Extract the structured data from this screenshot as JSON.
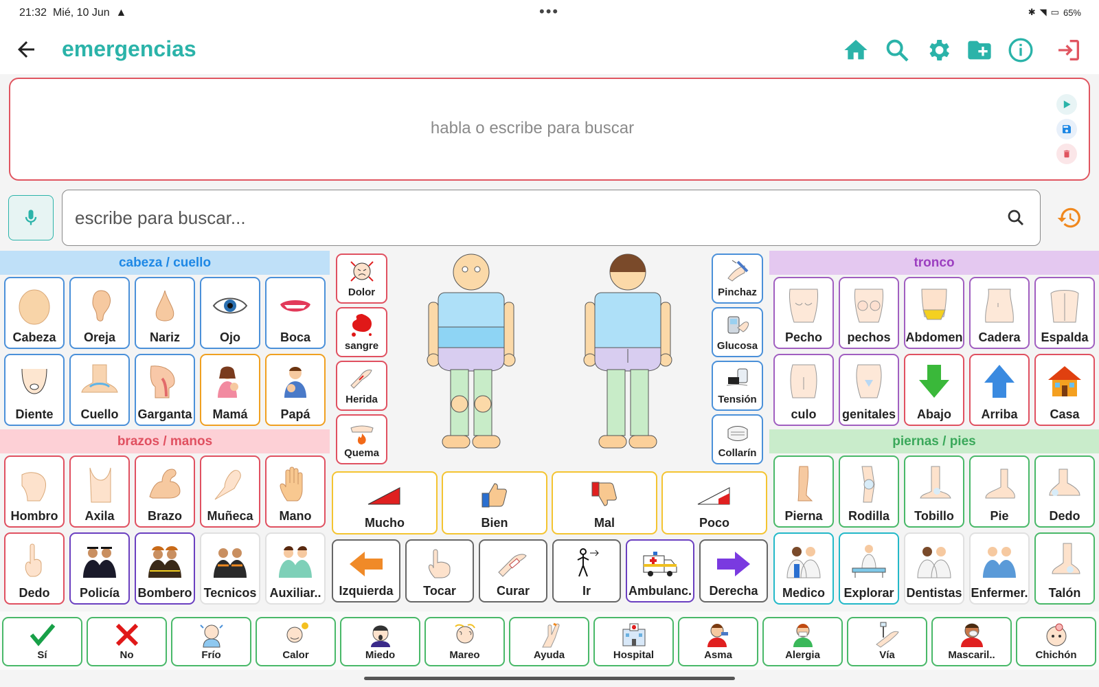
{
  "status": {
    "time": "21:32",
    "date": "Mié, 10 Jun",
    "battery": "65%"
  },
  "header": {
    "title": "emergencias"
  },
  "speech": {
    "placeholder": "habla o escribe para buscar"
  },
  "search": {
    "placeholder": "escribe para buscar..."
  },
  "categories": {
    "head": "cabeza / cuello",
    "arms": "brazos / manos",
    "trunk": "tronco",
    "legs": "piernas / pies"
  },
  "colors": {
    "accent": "#2bb3a9",
    "danger": "#e05560",
    "head_bg": "#bfe0f8",
    "arms_bg": "#fdd0d6",
    "trunk_bg": "#e4c8f0",
    "legs_bg": "#c9eccb"
  },
  "head_tiles": [
    "Cabeza",
    "Oreja",
    "Nariz",
    "Ojo",
    "Boca",
    "Diente",
    "Cuello",
    "Garganta",
    "Mamá",
    "Papá"
  ],
  "arm_tiles": [
    "Hombro",
    "Axila",
    "Brazo",
    "Muñeca",
    "Mano",
    "Dedo",
    "Policía",
    "Bombero",
    "Tecnicos",
    "Auxiliar.."
  ],
  "symptom_left": [
    "Dolor",
    "sangre",
    "Herida",
    "Quema"
  ],
  "symptom_right": [
    "Pinchaz",
    "Glucosa",
    "Tensión",
    "Collarín"
  ],
  "intensity": [
    "Mucho",
    "Bien",
    "Mal",
    "Poco"
  ],
  "actions": [
    "Izquierda",
    "Tocar",
    "Curar",
    "Ir",
    "Ambulanc.",
    "Derecha"
  ],
  "trunk_tiles": [
    "Pecho",
    "pechos",
    "Abdomen",
    "Cadera",
    "Espalda",
    "culo",
    "genitales",
    "Abajo",
    "Arriba",
    "Casa"
  ],
  "leg_tiles": [
    "Pierna",
    "Rodilla",
    "Tobillo",
    "Pie",
    "Dedo",
    "Medico",
    "Explorar",
    "Dentistas",
    "Enfermer.",
    "Talón"
  ],
  "bottom_tiles": [
    "Sí",
    "No",
    "Frío",
    "Calor",
    "Miedo",
    "Mareo",
    "Ayuda",
    "Hospital",
    "Asma",
    "Alergia",
    "Vía",
    "Mascaril..",
    "Chichón"
  ]
}
